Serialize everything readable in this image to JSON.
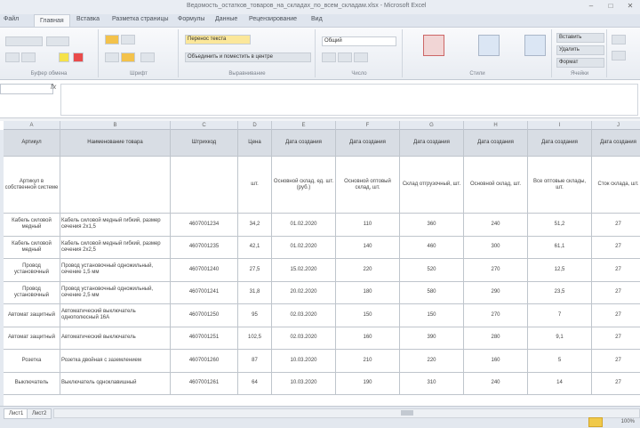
{
  "window": {
    "title": "Ведомость_остатков_товаров_на_складах_по_всем_складам.xlsx - Microsoft Excel",
    "controls": [
      "–",
      "□",
      "✕"
    ]
  },
  "ribbon_tabs": [
    "Файл",
    "Главная",
    "Вставка",
    "Разметка страницы",
    "Формулы",
    "Данные",
    "Рецензирование",
    "Вид"
  ],
  "ribbon": {
    "groups": [
      "Буфер обмена",
      "Шрифт",
      "Выравнивание",
      "Число",
      "Стили",
      "Ячейки"
    ],
    "wrap_text_label": "Перенос текста",
    "merge_label": "Объединить и поместить в центре",
    "number_format": "Общий",
    "insert_label": "Вставить",
    "delete_label": "Удалить",
    "format_label": "Формат"
  },
  "formula_bar": {
    "name_box": "",
    "fx": "fx",
    "content": ""
  },
  "sheet": {
    "columns": [
      "A",
      "B",
      "C",
      "D",
      "E",
      "F",
      "G",
      "H",
      "I",
      "J"
    ],
    "header": [
      "Артикул",
      "Наименование товара",
      "Штрихкод",
      "Цена",
      "Дата создания",
      "Дата создания",
      "Дата создания",
      "Дата создания",
      "Дата создания",
      "Дата создания"
    ],
    "subheader": [
      "Артикул в собственной системе",
      "",
      "",
      "шт.",
      "Основной склад, ед. шт. (руб.)",
      "Основной оптовый склад, шт.",
      "Склад отгрузочный, шт.",
      "Основной склад, шт.",
      "Все оптовые склады, шт.",
      "Сток склада, шт."
    ],
    "rows": [
      [
        "Кабель силовой медный",
        "Кабель силовой медный гибкий, размер сечения 2х1,5",
        "4607001234",
        "34,2",
        "01.02.2020",
        "110",
        "360",
        "240",
        "51,2",
        "27"
      ],
      [
        "Кабель силовой медный",
        "Кабель силовой медный гибкий, размер сечения 2х2,5",
        "4607001235",
        "42,1",
        "01.02.2020",
        "140",
        "460",
        "300",
        "61,1",
        "27"
      ],
      [
        "Провод установочный",
        "Провод установочный одножильный, сечение 1,5 мм",
        "4607001240",
        "27,5",
        "15.02.2020",
        "220",
        "520",
        "270",
        "12,5",
        "27"
      ],
      [
        "Провод установочный",
        "Провод установочный одножильный, сечение 2,5 мм",
        "4607001241",
        "31,8",
        "20.02.2020",
        "180",
        "580",
        "290",
        "23,5",
        "27"
      ],
      [
        "Автомат защитный",
        "Автоматический выключатель однополюсный 16А",
        "4607001250",
        "95",
        "02.03.2020",
        "150",
        "150",
        "270",
        "7",
        "27"
      ],
      [
        "Автомат защитный",
        "Автоматический выключатель",
        "4607001251",
        "102,5",
        "02.03.2020",
        "160",
        "390",
        "280",
        "9,1",
        "27"
      ],
      [
        "Розетка",
        "Розетка двойная с заземлением",
        "4607001260",
        "87",
        "10.03.2020",
        "210",
        "220",
        "160",
        "5",
        "27"
      ],
      [
        "Выключатель",
        "Выключатель одноклавишный",
        "4607001261",
        "64",
        "10.03.2020",
        "190",
        "310",
        "240",
        "14",
        "27"
      ]
    ]
  },
  "status_bar": {
    "sheets": [
      "Лист1",
      "Лист2"
    ],
    "zoom": "100%"
  }
}
